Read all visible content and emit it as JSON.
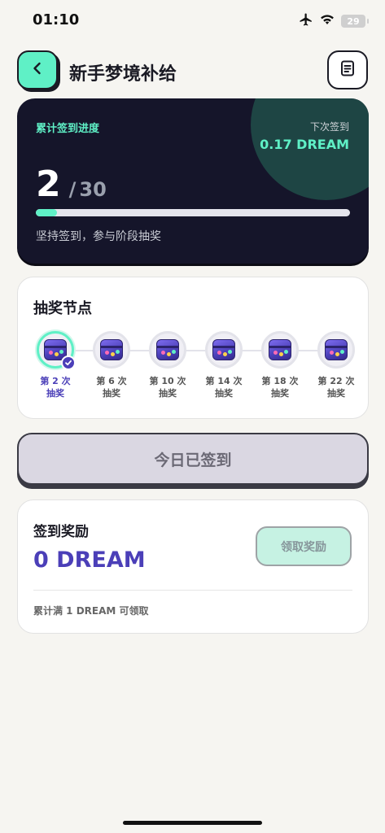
{
  "status_bar": {
    "time": "01:10",
    "battery_level": "29",
    "icons": [
      "airplane-icon",
      "wifi-icon",
      "battery-icon"
    ]
  },
  "header": {
    "title": "新手梦境补给",
    "back_icon": "chevron-left-icon",
    "doc_icon": "document-icon"
  },
  "progress": {
    "label": "累计签到进度",
    "next_label": "下次签到",
    "next_value": "0.17 DREAM",
    "current": "2",
    "separator": "/",
    "total": "30",
    "progress_fraction": 0.0667,
    "hint": "坚持签到，参与阶段抽奖"
  },
  "lottery": {
    "title": "抽奖节点",
    "nodes": [
      {
        "line1": "第 2 次",
        "line2": "抽奖",
        "active": true
      },
      {
        "line1": "第 6 次",
        "line2": "抽奖",
        "active": false
      },
      {
        "line1": "第 10 次",
        "line2": "抽奖",
        "active": false
      },
      {
        "line1": "第 14 次",
        "line2": "抽奖",
        "active": false
      },
      {
        "line1": "第 18 次",
        "line2": "抽奖",
        "active": false
      },
      {
        "line1": "第 22 次",
        "line2": "抽奖",
        "active": false
      }
    ]
  },
  "checkin": {
    "label": "今日已签到"
  },
  "reward": {
    "title": "签到奖励",
    "value": "0 DREAM",
    "claim_label": "领取奖励",
    "note": "累计满 1 DREAM 可领取"
  },
  "colors": {
    "accent_mint": "#5ff0c6",
    "accent_purple": "#4b3fb8",
    "dark_card": "#15152a"
  }
}
